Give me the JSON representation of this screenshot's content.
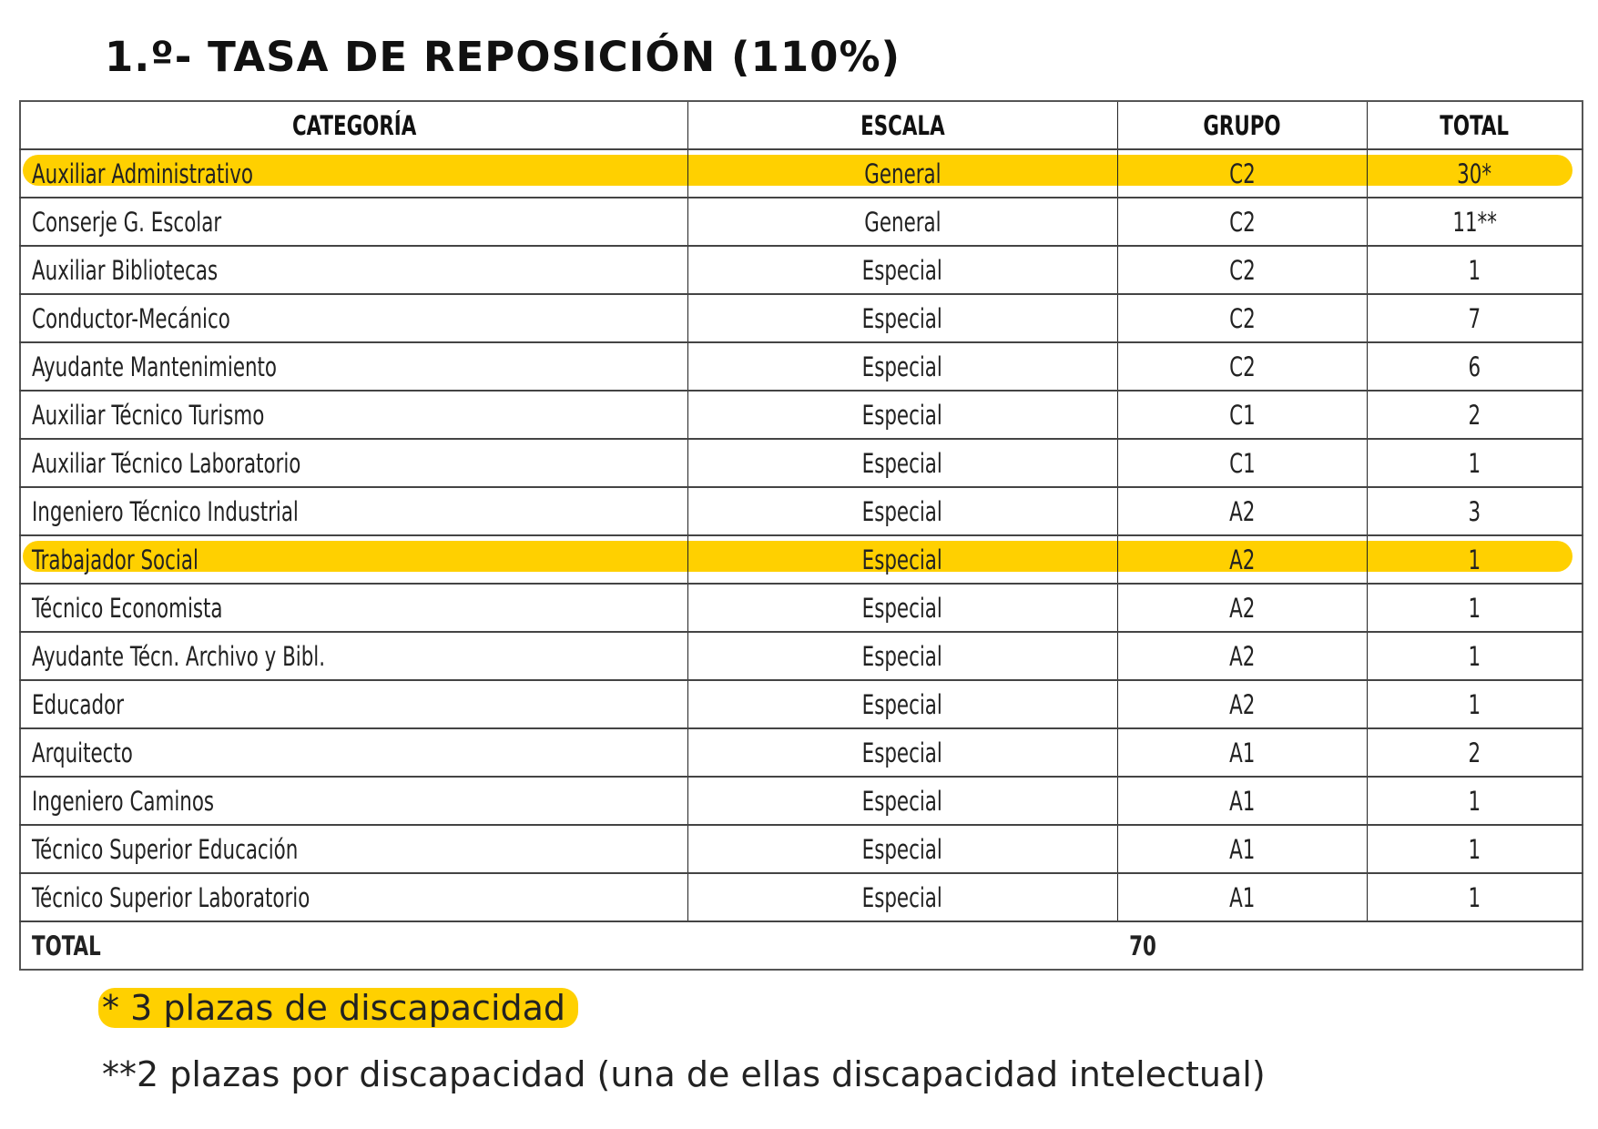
{
  "title": "1.º- TASA DE REPOSICIÓN (110%)",
  "table": {
    "headers": [
      "CATEGORÍA",
      "ESCALA",
      "GRUPO",
      "TOTAL"
    ],
    "rows": [
      {
        "categoria": "Auxiliar Administrativo",
        "escala": "General",
        "grupo": "C2",
        "total": "30*",
        "highlighted": true
      },
      {
        "categoria": "Conserje G. Escolar",
        "escala": "General",
        "grupo": "C2",
        "total": "11**",
        "highlighted": false
      },
      {
        "categoria": "Auxiliar Bibliotecas",
        "escala": "Especial",
        "grupo": "C2",
        "total": "1",
        "highlighted": false
      },
      {
        "categoria": "Conductor-Mecánico",
        "escala": "Especial",
        "grupo": "C2",
        "total": "7",
        "highlighted": false
      },
      {
        "categoria": "Ayudante Mantenimiento",
        "escala": "Especial",
        "grupo": "C2",
        "total": "6",
        "highlighted": false
      },
      {
        "categoria": "Auxiliar Técnico Turismo",
        "escala": "Especial",
        "grupo": "C1",
        "total": "2",
        "highlighted": false
      },
      {
        "categoria": "Auxiliar Técnico Laboratorio",
        "escala": "Especial",
        "grupo": "C1",
        "total": "1",
        "highlighted": false
      },
      {
        "categoria": "Ingeniero Técnico Industrial",
        "escala": "Especial",
        "grupo": "A2",
        "total": "3",
        "highlighted": false
      },
      {
        "categoria": "Trabajador Social",
        "escala": "Especial",
        "grupo": "A2",
        "total": "1",
        "highlighted": true
      },
      {
        "categoria": "Técnico Economista",
        "escala": "Especial",
        "grupo": "A2",
        "total": "1",
        "highlighted": false
      },
      {
        "categoria": "Ayudante Técn. Archivo y Bibl.",
        "escala": "Especial",
        "grupo": "A2",
        "total": "1",
        "highlighted": false
      },
      {
        "categoria": "Educador",
        "escala": "Especial",
        "grupo": "A2",
        "total": "1",
        "highlighted": false
      },
      {
        "categoria": "Arquitecto",
        "escala": "Especial",
        "grupo": "A1",
        "total": "2",
        "highlighted": false
      },
      {
        "categoria": "Ingeniero Caminos",
        "escala": "Especial",
        "grupo": "A1",
        "total": "1",
        "highlighted": false
      },
      {
        "categoria": "Técnico Superior Educación",
        "escala": "Especial",
        "grupo": "A1",
        "total": "1",
        "highlighted": false
      },
      {
        "categoria": "Técnico Superior Laboratorio",
        "escala": "Especial",
        "grupo": "A1",
        "total": "1",
        "highlighted": false
      }
    ],
    "total_label": "TOTAL",
    "total_value": "70"
  },
  "footnotes": [
    {
      "text": "* 3 plazas de discapacidad",
      "highlighted": true
    },
    {
      "text": "**2 plazas por discapacidad (una de ellas discapacidad intelectual)",
      "highlighted": false
    }
  ],
  "colors": {
    "highlight": "#ffd000",
    "text": "#1a1a1a",
    "border": "#444444"
  }
}
